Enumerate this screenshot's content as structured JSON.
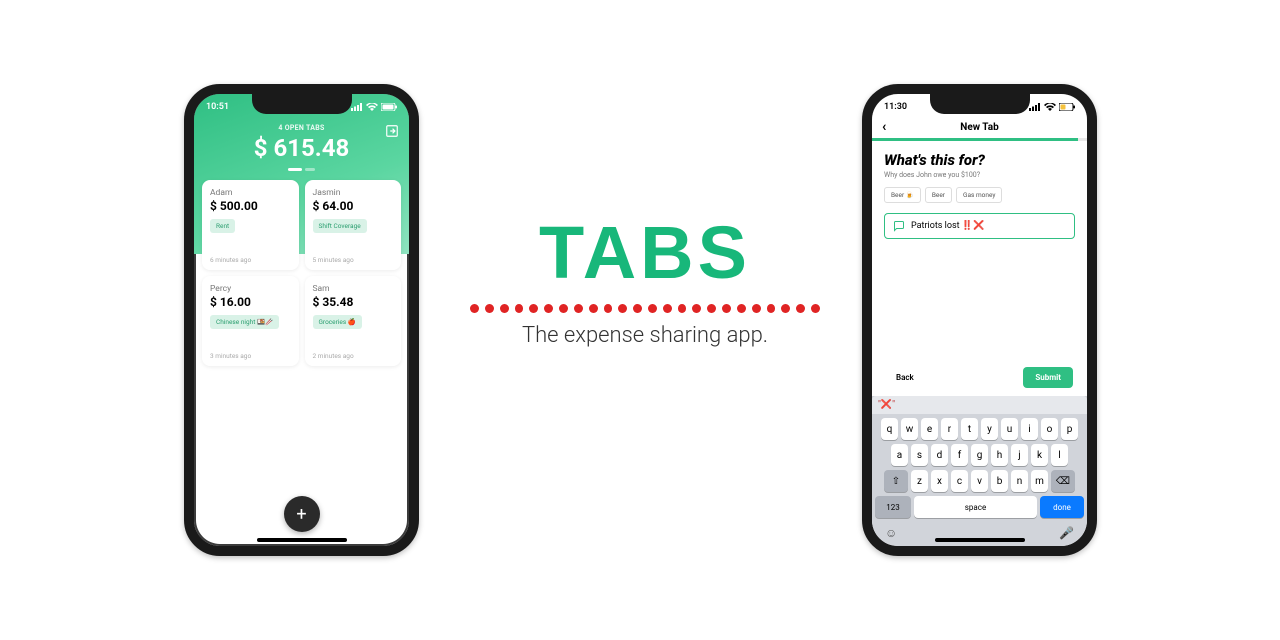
{
  "marketing": {
    "brand": "TABS",
    "tagline": "The expense sharing app."
  },
  "phone1": {
    "status_time": "10:51",
    "header": {
      "open_tabs_label": "4 OPEN TABS",
      "total": "$ 615.48"
    },
    "cards": [
      {
        "name": "Adam",
        "amount": "$ 500.00",
        "tag": "Rent",
        "time": "6 minutes ago"
      },
      {
        "name": "Jasmin",
        "amount": "$ 64.00",
        "tag": "Shift Coverage",
        "time": "5 minutes ago"
      },
      {
        "name": "Percy",
        "amount": "$ 16.00",
        "tag": "Chinese night 🍱🥢",
        "time": "3 minutes ago"
      },
      {
        "name": "Sam",
        "amount": "$ 35.48",
        "tag": "Groceries 🍎",
        "time": "2 minutes ago"
      }
    ],
    "fab_icon": "+"
  },
  "phone2": {
    "status_time": "11:30",
    "nav": {
      "title": "New Tab",
      "back_glyph": "‹"
    },
    "form": {
      "heading": "What's this for?",
      "subheading": "Why does John owe you $100?",
      "chips": [
        "Beer 🍺",
        "Beer",
        "Gas money"
      ],
      "reason_value": "Patriots lost ‼️❌"
    },
    "actions": {
      "back": "Back",
      "submit": "Submit"
    },
    "keyboard": {
      "suggestion": "\"❌\"",
      "row1": [
        "q",
        "w",
        "e",
        "r",
        "t",
        "y",
        "u",
        "i",
        "o",
        "p"
      ],
      "row2": [
        "a",
        "s",
        "d",
        "f",
        "g",
        "h",
        "j",
        "k",
        "l"
      ],
      "row3": [
        "z",
        "x",
        "c",
        "v",
        "b",
        "n",
        "m"
      ],
      "shift": "⇧",
      "backspace": "⌫",
      "num": "123",
      "space": "space",
      "done": "done",
      "emoji": "☺",
      "mic": "🎤"
    }
  }
}
